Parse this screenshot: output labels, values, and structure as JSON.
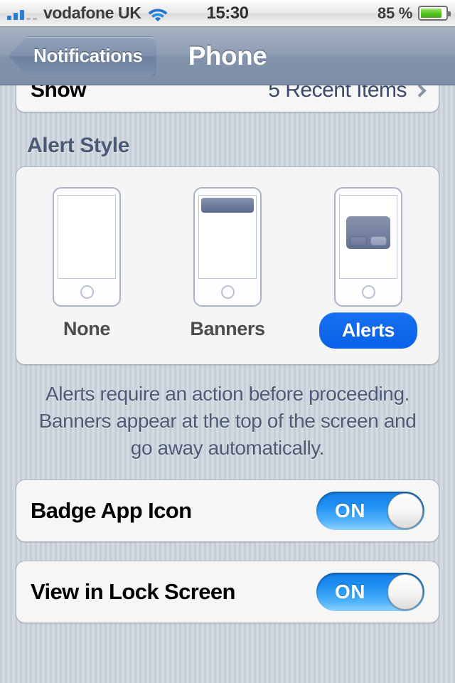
{
  "statusbar": {
    "carrier": "vodafone UK",
    "signal_bars_filled": 3,
    "signal_bars_total": 5,
    "wifi_icon": "wifi-icon",
    "time": "15:30",
    "battery_percent": "85 %",
    "battery_level": 85,
    "battery_color": "#53c223"
  },
  "navbar": {
    "back_label": "Notifications",
    "title": "Phone"
  },
  "clipped_row": {
    "label": "Show",
    "value": "5 Recent Items",
    "chevron_icon": "chevron-right-icon"
  },
  "alert_style": {
    "header": "Alert Style",
    "selected": "Alerts",
    "accent_color": "#0a62e8",
    "options": [
      {
        "label": "None",
        "preview": "none",
        "selected": false
      },
      {
        "label": "Banners",
        "preview": "banner",
        "selected": false
      },
      {
        "label": "Alerts",
        "preview": "alert",
        "selected": true
      }
    ],
    "footer_lines": [
      "Alerts require an action before proceeding.",
      "Banners appear at the top of the screen and",
      "go away automatically."
    ]
  },
  "toggles": [
    {
      "label": "Badge App Icon",
      "value": "ON",
      "on": true
    },
    {
      "label": "View in Lock Screen",
      "value": "ON",
      "on": true
    }
  ]
}
